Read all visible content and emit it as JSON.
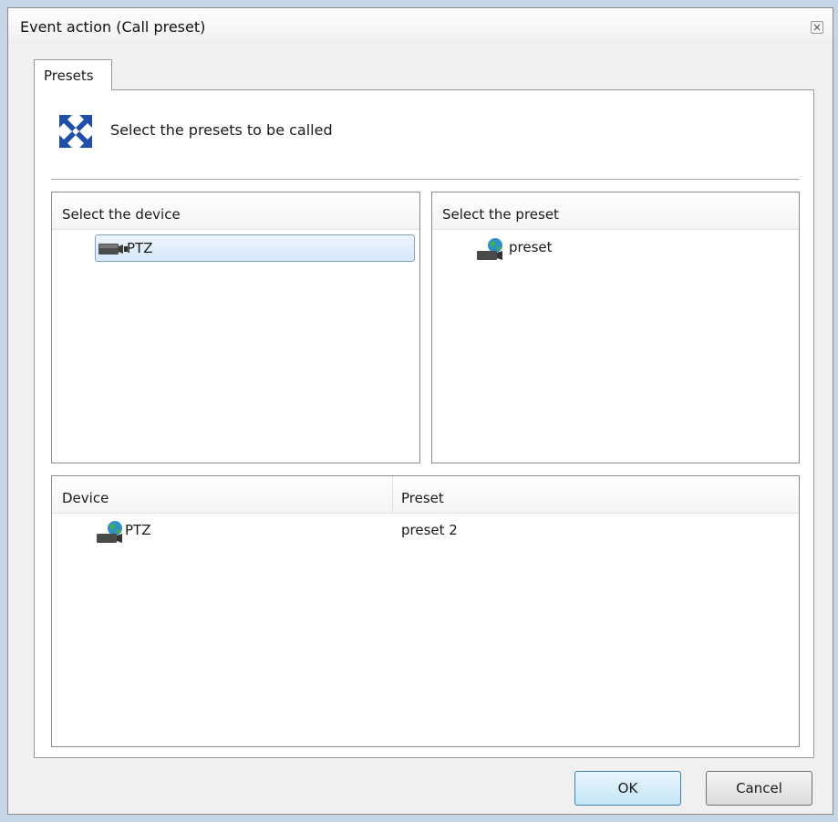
{
  "window": {
    "title": "Event action (Call preset)"
  },
  "tabs": [
    {
      "label": "Presets",
      "active": true
    }
  ],
  "header": {
    "icon": "fullscreen-arrows-icon",
    "text": "Select the presets to be called"
  },
  "device_panel": {
    "header": "Select the device",
    "items": [
      {
        "label": "PTZ",
        "icon": "camera-icon",
        "selected": true
      }
    ]
  },
  "preset_panel": {
    "header": "Select the preset",
    "items": [
      {
        "label": "preset",
        "icon": "globe-camera-icon"
      }
    ]
  },
  "selection_list": {
    "columns": [
      "Device",
      "Preset"
    ],
    "rows": [
      {
        "device": "PTZ",
        "preset": "preset 2",
        "icon": "globe-camera-icon"
      }
    ]
  },
  "buttons": {
    "ok": "OK",
    "cancel": "Cancel"
  },
  "colors": {
    "selection_border": "#7da2ce",
    "default_button_border": "#3c7fb1"
  }
}
